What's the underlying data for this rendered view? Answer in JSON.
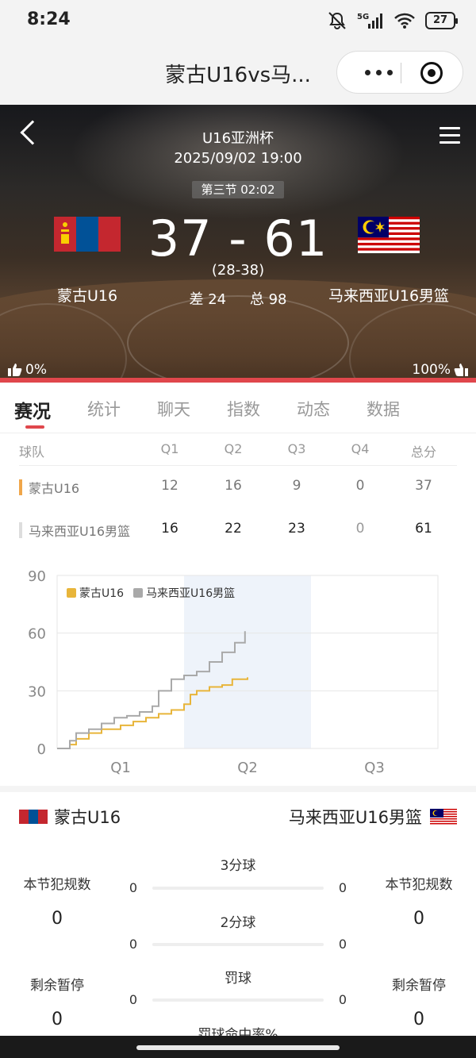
{
  "status_bar": {
    "time": "8:24",
    "network": "5G",
    "battery": "27"
  },
  "nav": {
    "title": "蒙古U16vs马..."
  },
  "match": {
    "league": "U16亚洲杯",
    "datetime": "2025/09/02 19:00",
    "period": "第三节 02:02",
    "home_team": "蒙古U16",
    "away_team": "马来西亚U16男篮",
    "score": "37 - 61",
    "half_score": "(28-38)",
    "diff": "差 24",
    "total": "总 98",
    "home_support": "0%",
    "away_support": "100%"
  },
  "tabs": [
    "赛况",
    "统计",
    "聊天",
    "指数",
    "动态",
    "数据"
  ],
  "score_table": {
    "headers": [
      "球队",
      "Q1",
      "Q2",
      "Q3",
      "Q4",
      "总分"
    ],
    "rows": [
      {
        "team": "蒙古U16",
        "q1": "12",
        "q2": "16",
        "q3": "9",
        "q4": "0",
        "total": "37",
        "color": "#f0a64a"
      },
      {
        "team": "马来西亚U16男篮",
        "q1": "16",
        "q2": "22",
        "q3": "23",
        "q4": "0",
        "total": "61",
        "color": "#dddddd"
      }
    ]
  },
  "chart_data": {
    "type": "line",
    "x_ticks": [
      "Q1",
      "Q2",
      "Q3"
    ],
    "y_ticks": [
      "90",
      "60",
      "30",
      "0"
    ],
    "ylim": [
      0,
      90
    ],
    "highlight_period": "Q2",
    "series": [
      {
        "name": "蒙古U16",
        "color": "#e8b53a",
        "x": [
          0,
          0.1,
          0.15,
          0.25,
          0.35,
          0.5,
          0.6,
          0.7,
          0.8,
          0.9,
          1.0,
          1.05,
          1.1,
          1.2,
          1.3,
          1.38,
          1.5
        ],
        "y": [
          0,
          2,
          5,
          8,
          10,
          12,
          14,
          16,
          18,
          20,
          23,
          28,
          30,
          32,
          33,
          36,
          37
        ]
      },
      {
        "name": "马来西亚U16男篮",
        "color": "#a9a9a9",
        "x": [
          0,
          0.1,
          0.15,
          0.25,
          0.35,
          0.45,
          0.55,
          0.65,
          0.75,
          0.8,
          0.9,
          1.0,
          1.1,
          1.2,
          1.3,
          1.4,
          1.48
        ],
        "y": [
          0,
          4,
          8,
          10,
          13,
          16,
          17,
          19,
          22,
          30,
          36,
          38,
          40,
          45,
          50,
          55,
          61
        ]
      }
    ]
  },
  "team_stats": {
    "home_name": "蒙古U16",
    "away_name": "马来西亚U16男篮",
    "rows": [
      {
        "label": "3分球",
        "home": "0",
        "away": "0"
      },
      {
        "label": "2分球",
        "home": "0",
        "away": "0"
      },
      {
        "label": "罚球",
        "home": "0",
        "away": "0"
      },
      {
        "label": "罚球命中率%"
      }
    ],
    "home_side": [
      {
        "label": "本节犯规数",
        "value": "0"
      },
      {
        "label": "剩余暂停",
        "value": "0"
      }
    ],
    "away_side": [
      {
        "label": "本节犯规数",
        "value": "0"
      },
      {
        "label": "剩余暂停",
        "value": "0"
      }
    ]
  }
}
